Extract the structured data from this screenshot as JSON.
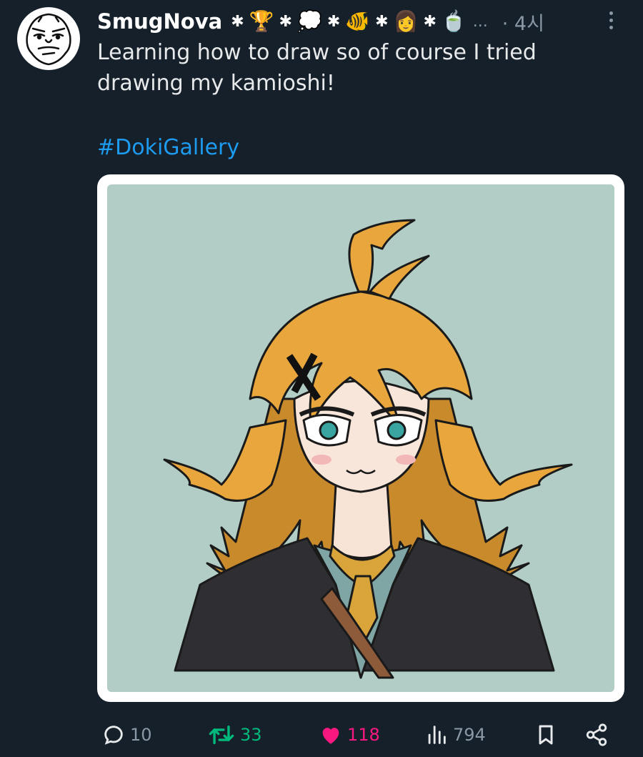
{
  "post": {
    "username": "SmugNova",
    "badges": [
      "🏆",
      "💭",
      "🐠",
      "👩",
      "🍵"
    ],
    "badge_separator": "✱",
    "ellipsis": "...",
    "time": "· 4시",
    "text_line1": "Learning how to draw so of course I tried",
    "text_line2": "drawing my kamioshi!",
    "hashtag": "#DokiGallery"
  },
  "actions": {
    "replies": "10",
    "reposts": "33",
    "likes": "118",
    "views": "794"
  },
  "colors": {
    "background": "#15202b",
    "link": "#1d9bf0",
    "muted": "#8b98a5",
    "repost": "#00ba7c",
    "like": "#f91880",
    "art_background": "#b2cdc5",
    "hair": "#e8a63c"
  },
  "icons": [
    "kebab-menu-icon",
    "reply-icon",
    "repost-icon",
    "heart-icon",
    "views-icon",
    "bookmark-icon",
    "share-icon"
  ]
}
